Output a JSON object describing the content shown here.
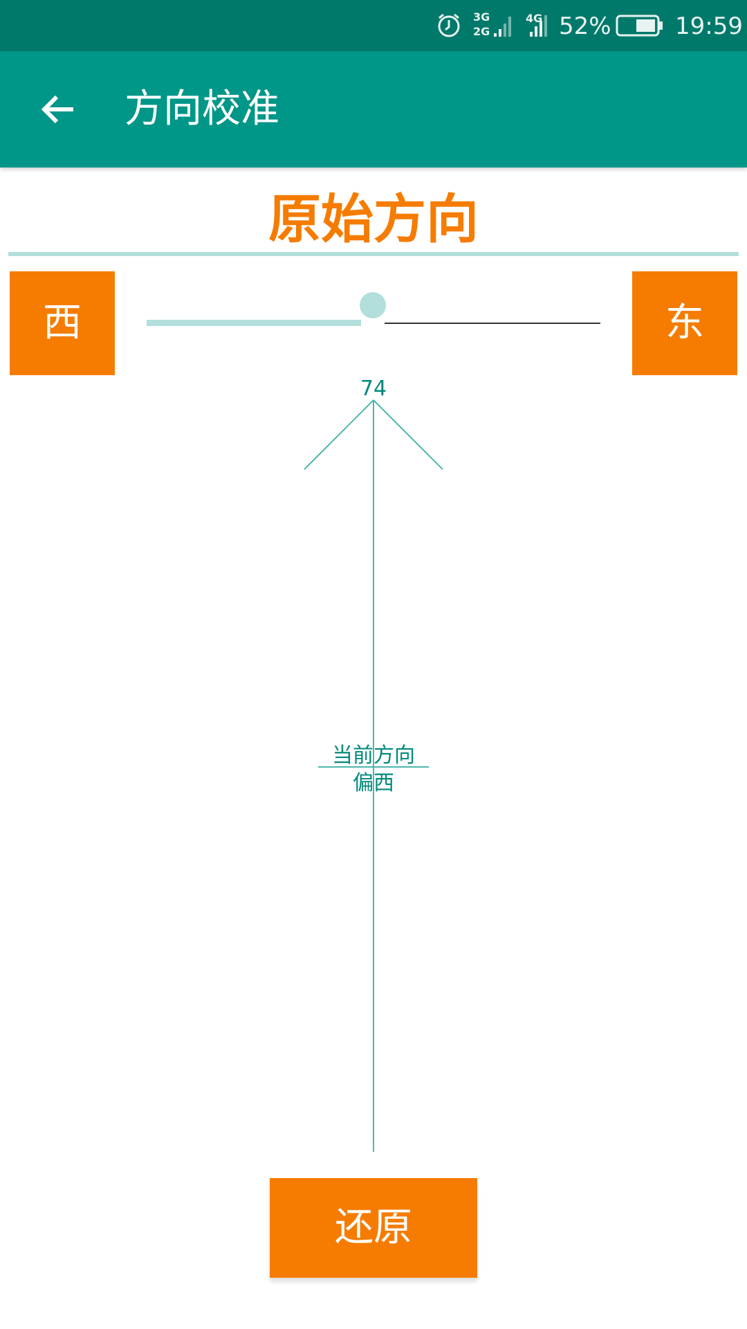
{
  "status_bar": {
    "network_1": "3G",
    "network_2": "2G",
    "network_3": "4G",
    "battery": "52%",
    "time": "19:59",
    "icons": [
      "alarm-icon",
      "signal-icon",
      "battery-icon"
    ]
  },
  "app_bar": {
    "title": "方向校准",
    "back_icon": "arrow-left-icon"
  },
  "main": {
    "heading": "原始方向",
    "west_label": "西",
    "east_label": "东",
    "slider_value_fraction": 0.54,
    "degree": "74",
    "current_label": "当前方向",
    "direction_label": "偏西",
    "reset_label": "还原"
  },
  "colors": {
    "statusbar": "#00796b",
    "appbar": "#009688",
    "accent": "#f57c00",
    "teal_text": "#00897b",
    "light_teal": "#b2dfdb"
  }
}
